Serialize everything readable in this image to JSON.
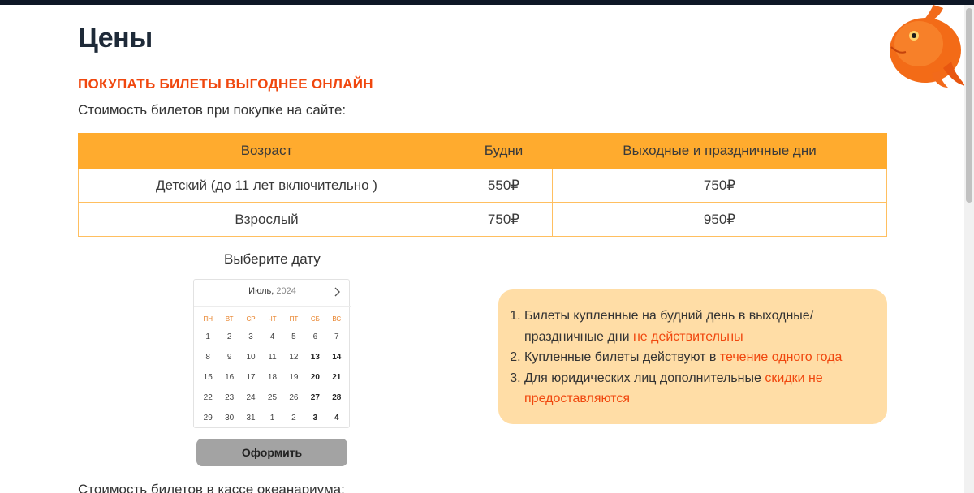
{
  "page": {
    "title": "Цены",
    "promo_heading": "ПОКУПАТЬ БИЛЕТЫ ВЫГОДНЕЕ ОНЛАЙН",
    "intro": "Стоимость билетов при покупке на сайте:",
    "bottom_text": "Стоимость билетов в кассе океанариума:"
  },
  "prices_table": {
    "headers": [
      "Возраст",
      "Будни",
      "Выходные и праздничные дни"
    ],
    "rows": [
      [
        "Детский (до 11 лет включительно )",
        "550₽",
        "750₽"
      ],
      [
        "Взрослый",
        "750₽",
        "950₽"
      ]
    ]
  },
  "date_picker": {
    "label": "Выберите дату",
    "month": "Июль,",
    "year": "2024",
    "weekdays": [
      "пн",
      "вт",
      "ср",
      "чт",
      "пт",
      "сб",
      "вс"
    ],
    "weeks": [
      [
        "1",
        "2",
        "3",
        "4",
        "5",
        "6",
        "7"
      ],
      [
        "8",
        "9",
        "10",
        "11",
        "12",
        "13",
        "14"
      ],
      [
        "15",
        "16",
        "17",
        "18",
        "19",
        "20",
        "21"
      ],
      [
        "22",
        "23",
        "24",
        "25",
        "26",
        "27",
        "28"
      ],
      [
        "29",
        "30",
        "31",
        "1",
        "2",
        "3",
        "4"
      ]
    ],
    "next_icon": "chevron-right-icon"
  },
  "submit": {
    "label": "Оформить"
  },
  "notes": {
    "items": [
      {
        "text": "Билеты купленные на будний день в выходные/ праздничные дни ",
        "highlight": "не действительны"
      },
      {
        "text": "Купленные билеты действуют в ",
        "highlight": "течение одного года"
      },
      {
        "text": "Для юридических лиц дополнительные ",
        "highlight": "скидки не предоставляются"
      }
    ]
  },
  "colors": {
    "accent": "#f0470e",
    "table_header": "#ffab2e",
    "notes_bg": "#ffdda6",
    "button_bg": "#a3a3a3",
    "topbar": "#0e1726"
  },
  "decor": {
    "fish_icon": "orange-fish-icon"
  }
}
